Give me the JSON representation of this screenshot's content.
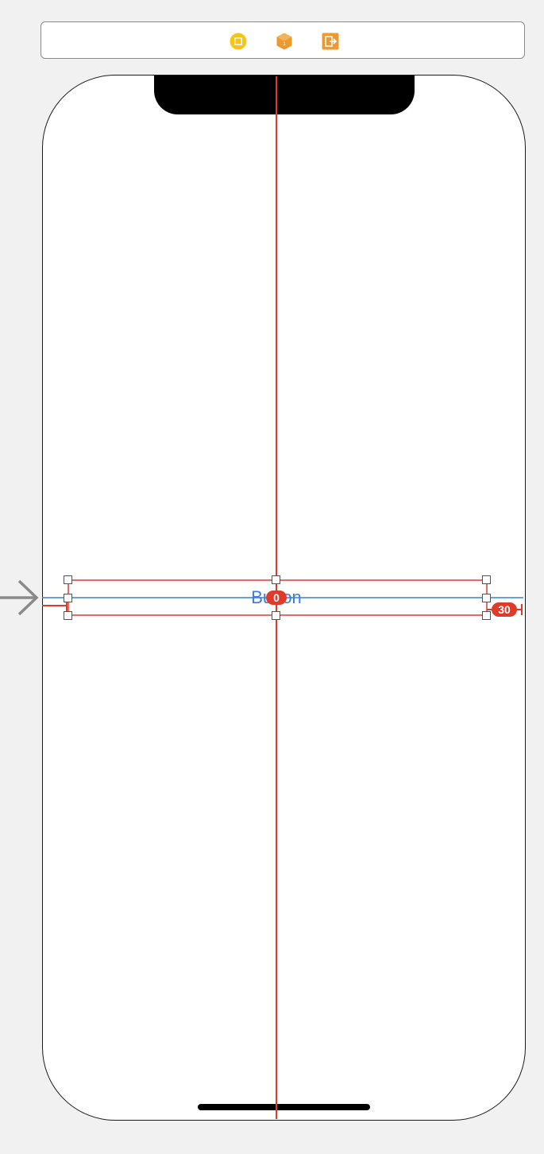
{
  "dock": {
    "icons": [
      {
        "name": "view-controller-icon",
        "color": "#f5c417"
      },
      {
        "name": "first-responder-icon",
        "color": "#ec9a2e"
      },
      {
        "name": "exit-icon",
        "color": "#ec9a2e"
      }
    ]
  },
  "canvas": {
    "button_title": "Button",
    "constraint_center_label": "0",
    "constraint_trailing_label": "30"
  },
  "colors": {
    "constraint": "#e03a2b",
    "baseline": "#3d7fd6",
    "handle_border": "#555555",
    "entry_arrow": "#8a8a8a",
    "background": "#f1f1f1"
  }
}
